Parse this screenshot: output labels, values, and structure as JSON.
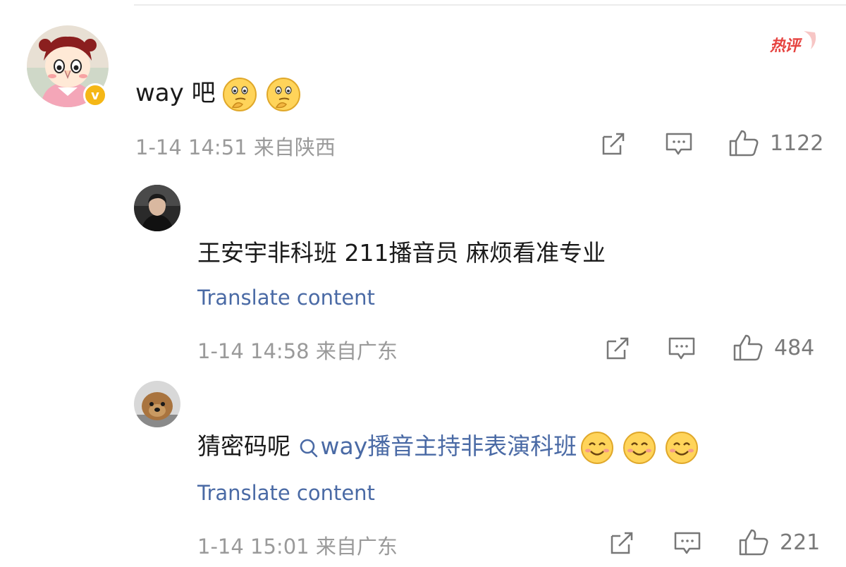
{
  "comment": {
    "text": "way 吧",
    "timestamp": "1-14 14:51",
    "location": "来自陕西",
    "likes": "1122",
    "hot_label": "热评"
  },
  "replies": [
    {
      "text": "王安宇非科班 211播音员 麻烦看准专业",
      "translate": "Translate content",
      "timestamp": "1-14 14:58",
      "location": "来自广东",
      "likes": "484"
    },
    {
      "text_prefix": "猜密码呢 ",
      "link": "way播音主持非表演科班",
      "translate": "Translate content",
      "timestamp": "1-14 15:01",
      "location": "来自广东",
      "likes": "221"
    }
  ],
  "icons": {
    "share": "share-icon",
    "comment": "comment-icon",
    "like": "like-icon"
  },
  "colors": {
    "link": "#4a6aa5",
    "hot": "#e64340",
    "verified": "#f5b716"
  }
}
